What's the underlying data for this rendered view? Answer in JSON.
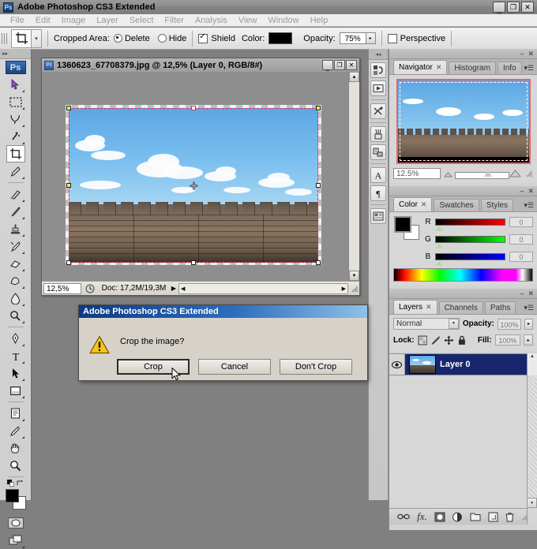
{
  "app": {
    "title": "Adobe Photoshop CS3 Extended",
    "logo_text": "Ps",
    "window_controls": {
      "minimize": "_",
      "maximize": "❐",
      "close": "✕"
    }
  },
  "menubar": {
    "items": [
      "File",
      "Edit",
      "Image",
      "Layer",
      "Select",
      "Filter",
      "Analysis",
      "View",
      "Window",
      "Help"
    ]
  },
  "options_bar": {
    "tool_icon": "crop-tool-icon",
    "cropped_area_label": "Cropped Area:",
    "delete_label": "Delete",
    "delete_selected": true,
    "hide_label": "Hide",
    "hide_selected": false,
    "shield_label": "Shield",
    "shield_checked": true,
    "color_label": "Color:",
    "color_value": "#000000",
    "opacity_label": "Opacity:",
    "opacity_value": "75%",
    "perspective_label": "Perspective",
    "perspective_checked": false
  },
  "toolbox": {
    "logo_text": "Ps",
    "tools": [
      {
        "name": "move-tool",
        "selected": false
      },
      {
        "name": "rectangular-marquee-tool",
        "selected": false
      },
      {
        "name": "lasso-tool",
        "selected": false
      },
      {
        "name": "magic-wand-tool",
        "selected": false
      },
      {
        "name": "crop-tool",
        "selected": true
      },
      {
        "name": "eyedropper-tool",
        "selected": false
      },
      {
        "name": "healing-brush-tool",
        "selected": false
      },
      {
        "name": "brush-tool",
        "selected": false
      },
      {
        "name": "clone-stamp-tool",
        "selected": false
      },
      {
        "name": "history-brush-tool",
        "selected": false
      },
      {
        "name": "eraser-tool",
        "selected": false
      },
      {
        "name": "gradient-tool",
        "selected": false
      },
      {
        "name": "blur-tool",
        "selected": false
      },
      {
        "name": "dodge-tool",
        "selected": false
      },
      {
        "name": "pen-tool",
        "selected": false
      },
      {
        "name": "type-tool",
        "selected": false
      },
      {
        "name": "path-selection-tool",
        "selected": false
      },
      {
        "name": "rectangle-shape-tool",
        "selected": false
      },
      {
        "name": "notes-tool",
        "selected": false
      },
      {
        "name": "eyedropper-sample-tool",
        "selected": false
      },
      {
        "name": "hand-tool",
        "selected": false
      },
      {
        "name": "zoom-tool",
        "selected": false
      }
    ],
    "foreground_color": "#000000",
    "background_color": "#ffffff"
  },
  "document": {
    "title": "1360623_67708379.jpg @ 12,5% (Layer 0, RGB/8#)",
    "window_controls": {
      "minimize": "_",
      "maximize": "❐",
      "close": "✕"
    },
    "status": {
      "zoom": "12,5%",
      "doc_label": "Doc: 17,2M/19,3M"
    }
  },
  "navigator_panel": {
    "tabs": [
      {
        "label": "Navigator",
        "active": true,
        "closable": true
      },
      {
        "label": "Histogram",
        "active": false,
        "closable": false
      },
      {
        "label": "Info",
        "active": false,
        "closable": false
      }
    ],
    "zoom_value": "12.5%",
    "thumb_border_color": "#e8616a"
  },
  "color_panel": {
    "tabs": [
      {
        "label": "Color",
        "active": true,
        "closable": true
      },
      {
        "label": "Swatches",
        "active": false,
        "closable": false
      },
      {
        "label": "Styles",
        "active": false,
        "closable": false
      }
    ],
    "channels": [
      {
        "letter": "R",
        "value": "0",
        "color": "#ff0000"
      },
      {
        "letter": "G",
        "value": "0",
        "color": "#00ff00"
      },
      {
        "letter": "B",
        "value": "0",
        "color": "#0000ff"
      }
    ],
    "foreground": "#000000",
    "background": "#ffffff"
  },
  "layers_panel": {
    "tabs": [
      {
        "label": "Layers",
        "active": true,
        "closable": true
      },
      {
        "label": "Channels",
        "active": false,
        "closable": false
      },
      {
        "label": "Paths",
        "active": false,
        "closable": false
      }
    ],
    "blend_mode": "Normal",
    "opacity_label": "Opacity:",
    "opacity_value": "100%",
    "lock_label": "Lock:",
    "fill_label": "Fill:",
    "fill_value": "100%",
    "lock_icons": [
      "lock-transparent-pixels-icon",
      "lock-image-pixels-icon",
      "lock-position-icon",
      "lock-all-icon"
    ],
    "layers": [
      {
        "name": "Layer 0",
        "visible": true,
        "selected": true
      }
    ],
    "bottom_icons": [
      "link-layers-icon",
      "layer-style-fx-icon",
      "layer-mask-icon",
      "adjustment-layer-icon",
      "new-group-icon",
      "new-layer-icon",
      "delete-layer-icon"
    ],
    "selected_row_color": "#16276e"
  },
  "dock_strip": {
    "buttons": [
      "bridge-icon",
      "screen-mode-icon",
      "tool-presets-icon",
      "brushes-icon",
      "clone-source-icon",
      "character-icon",
      "paragraph-icon",
      "layer-comps-icon"
    ]
  },
  "dialog": {
    "title": "Adobe Photoshop CS3 Extended",
    "icon": "warning-triangle-icon",
    "message": "Crop the image?",
    "buttons": [
      {
        "label": "Crop",
        "default": true
      },
      {
        "label": "Cancel",
        "default": false
      },
      {
        "label": "Don't Crop",
        "default": false
      }
    ],
    "cursor": "mouse-pointer-icon"
  },
  "canvas": {
    "image_description": "castle-battlement-photo",
    "sky_color": "#7cc0ef",
    "wall_color": "#7a6a5c",
    "crop_marquee_color": "#e0355f",
    "handle_color": "#e9ec46"
  }
}
